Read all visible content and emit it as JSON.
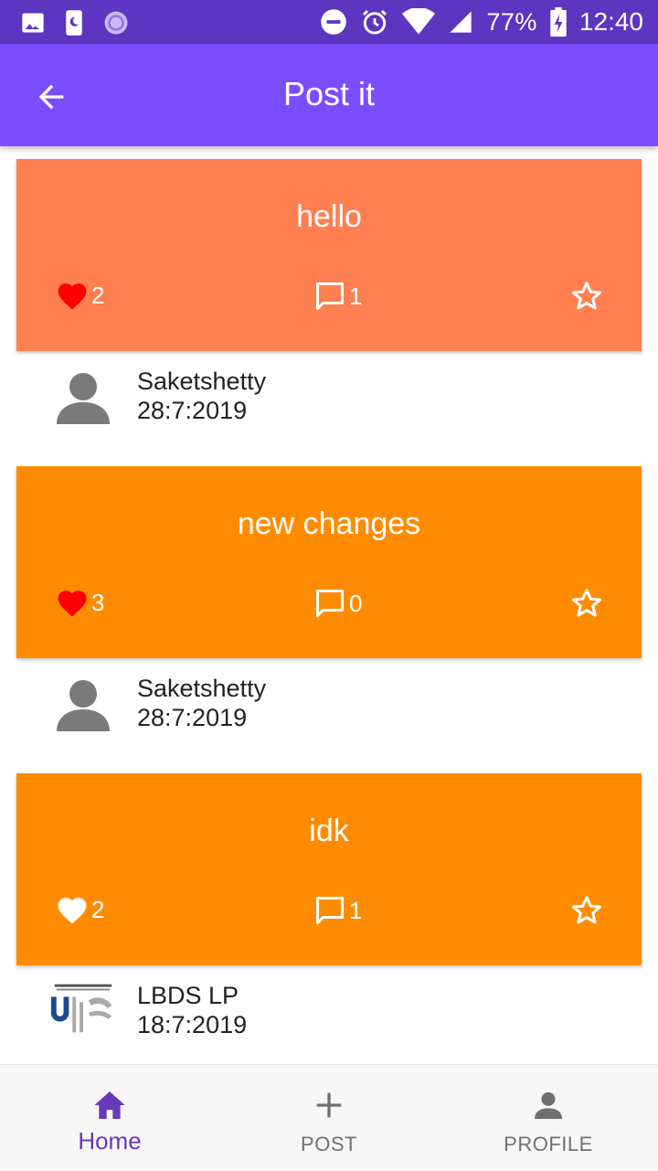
{
  "status_bar": {
    "battery": "77%",
    "time": "12:40",
    "icons": [
      "image-icon",
      "phone-icon",
      "app-icon",
      "dnd-icon",
      "alarm-icon",
      "wifi-icon",
      "signal-icon",
      "battery-icon"
    ]
  },
  "app_bar": {
    "title": "Post it",
    "back_icon": "arrow-back-icon"
  },
  "posts": [
    {
      "title": "hello",
      "likes": "2",
      "comments": "1",
      "liked": true,
      "bg": "#ff7f50",
      "author": "Saketshetty",
      "date": "28:7:2019",
      "avatar": "person-avatar"
    },
    {
      "title": "new changes",
      "likes": "3",
      "comments": "0",
      "liked": true,
      "bg": "#ff8c00",
      "author": "Saketshetty",
      "date": "28:7:2019",
      "avatar": "person-avatar"
    },
    {
      "title": "idk",
      "likes": "2",
      "comments": "1",
      "liked": false,
      "bg": "#ff8c00",
      "author": "LBDS LP",
      "date": "18:7:2019",
      "avatar": "university-logo"
    }
  ],
  "bottom_nav": {
    "home": "Home",
    "post": "POST",
    "profile": "PROFILE",
    "active": "home"
  },
  "colors": {
    "status_bar": "#5c35c0",
    "app_bar": "#7c4dff",
    "liked_heart": "#ff0000",
    "nav_active": "#673ab7",
    "nav_inactive": "#707070"
  }
}
